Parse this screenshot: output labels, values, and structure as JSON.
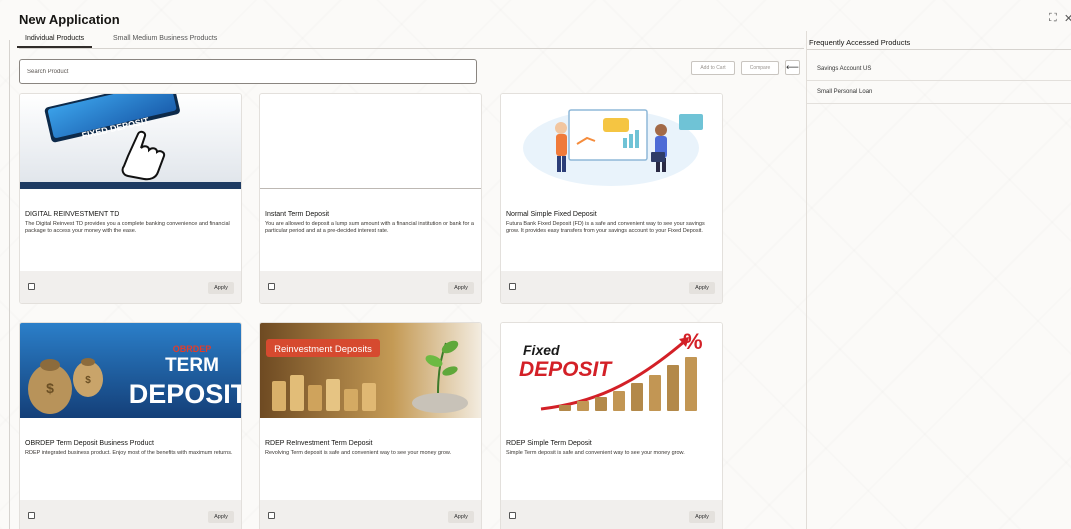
{
  "page": {
    "title": "New Application",
    "expand_glyph": "⛶",
    "close_glyph": "✕"
  },
  "tabs": [
    {
      "label": "Individual Products",
      "active": true
    },
    {
      "label": "Small Medium Business Products",
      "active": false
    }
  ],
  "search": {
    "placeholder": "Search Product",
    "value": ""
  },
  "toolbar": {
    "add_to_cart_label": "Add to Cart",
    "compare_label": "Compare",
    "back_glyph": "⟵"
  },
  "products": [
    {
      "title": "DIGITAL REINVESTMENT TD",
      "description": "The Digital Reinvest TD provides you a complete banking convenience and financial package to access your money with the ease.",
      "image_text": "FIXED DEPOSIT",
      "apply_label": "Apply"
    },
    {
      "title": "Instant Term Deposit",
      "description": "You are allowed to deposit a lump sum amount with a financial institution or bank for a particular period and at a pre-decided interest rate.",
      "apply_label": "Apply"
    },
    {
      "title": "Normal Simple Fixed Deposit",
      "description": "Futura Bank Fixed Deposit (FD) is a safe and convenient way to see your savings grow. It provides easy transfers from your savings account to your Fixed Deposit.",
      "apply_label": "Apply"
    },
    {
      "title": "OBRDEP Term Deposit Business Product",
      "description": "RDEP integrated business product. Enjoy most of the benefits with maximum returns.",
      "image_lines": [
        "OBRDEP",
        "TERM",
        "DEPOSIT"
      ],
      "apply_label": "Apply"
    },
    {
      "title": "RDEP ReInvestment Term Deposit",
      "description": "Revolving Term deposit is safe and convenient way to see your money grow.",
      "image_text": "Reinvestment Deposits",
      "apply_label": "Apply"
    },
    {
      "title": "RDEP Simple Term Deposit",
      "description": "Simple Term deposit is safe and convenient way to see your money grow.",
      "image_lines": [
        "Fixed",
        "DEPOSIT"
      ],
      "image_badge": "%",
      "apply_label": "Apply"
    }
  ],
  "frequent": {
    "title": "Frequently Accessed Products",
    "items": [
      "Savings Account US",
      "Small Personal Loan"
    ]
  },
  "colors": {
    "accent": "#312d2a",
    "blue_banner": "#2f6fb5",
    "red_text": "#d32027"
  }
}
